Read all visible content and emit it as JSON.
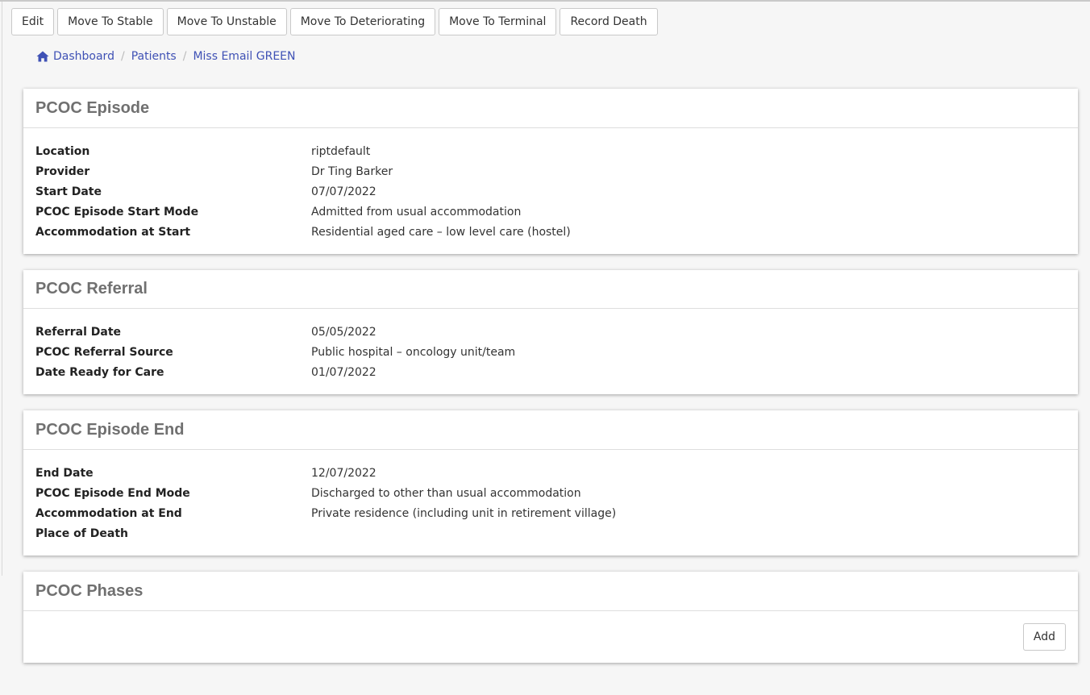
{
  "toolbar": {
    "buttons": [
      "Edit",
      "Move To Stable",
      "Move To Unstable",
      "Move To Deteriorating",
      "Move To Terminal",
      "Record Death"
    ]
  },
  "breadcrumb": {
    "icon": "home-icon",
    "items": [
      "Dashboard",
      "Patients",
      "Miss Email GREEN"
    ]
  },
  "episode": {
    "title": "PCOC Episode",
    "rows": [
      {
        "label": "Location",
        "value": "riptdefault"
      },
      {
        "label": "Provider",
        "value": "Dr Ting Barker"
      },
      {
        "label": "Start Date",
        "value": "07/07/2022"
      },
      {
        "label": "PCOC Episode Start Mode",
        "value": "Admitted from usual accommodation"
      },
      {
        "label": "Accommodation at Start",
        "value": "Residential aged care – low level care (hostel)"
      }
    ]
  },
  "referral": {
    "title": "PCOC Referral",
    "rows": [
      {
        "label": "Referral Date",
        "value": "05/05/2022"
      },
      {
        "label": "PCOC Referral Source",
        "value": "Public hospital – oncology unit/team"
      },
      {
        "label": "Date Ready for Care",
        "value": "01/07/2022"
      }
    ]
  },
  "episode_end": {
    "title": "PCOC Episode End",
    "rows": [
      {
        "label": "End Date",
        "value": "12/07/2022"
      },
      {
        "label": "PCOC Episode End Mode",
        "value": "Discharged to other than usual accommodation"
      },
      {
        "label": "Accommodation at End",
        "value": "Private residence (including unit in retirement village)"
      },
      {
        "label": "Place of Death",
        "value": ""
      }
    ]
  },
  "phases": {
    "title": "PCOC Phases",
    "add_label": "Add"
  },
  "colors": {
    "link": "#3f51b5",
    "heading": "#707070",
    "background": "#f6f6f6"
  }
}
